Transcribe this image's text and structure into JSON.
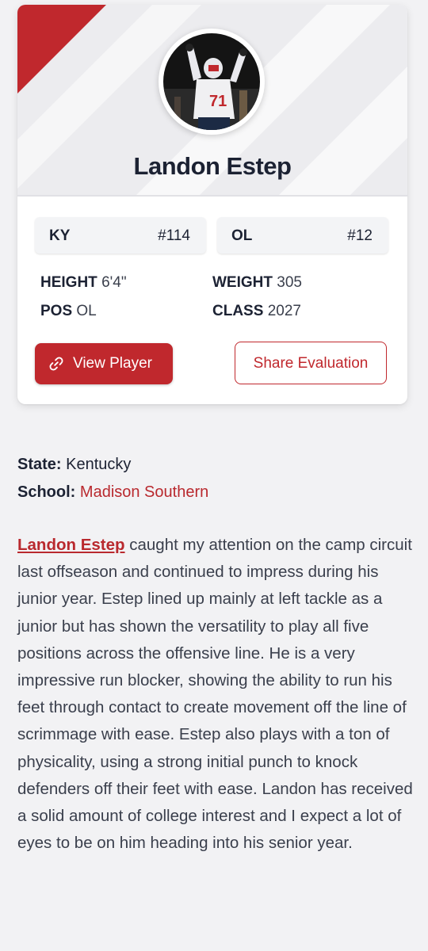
{
  "card": {
    "player_name": "Landon Estep",
    "state_box": {
      "label": "KY",
      "rank": "#114"
    },
    "position_box": {
      "label": "OL",
      "rank": "#12"
    },
    "attributes": {
      "height_label": "HEIGHT",
      "height_value": "6'4\"",
      "weight_label": "WEIGHT",
      "weight_value": "305",
      "pos_label": "POS",
      "pos_value": "OL",
      "class_label": "CLASS",
      "class_value": "2027"
    },
    "view_button_label": "View Player",
    "share_button_label": "Share Evaluation"
  },
  "details": {
    "state_label": "State:",
    "state_value": "Kentucky",
    "school_label": "School:",
    "school_value": "Madison Southern"
  },
  "bio": {
    "name_link": "Landon Estep",
    "text": " caught my attention on the camp circuit last offseason and continued to impress during his junior year. Estep lined up mainly at left tackle as a junior but has shown the versatility to play all five positions across the offensive line. He is a very impressive run blocker, showing the ability to run his feet through contact to create movement off the line of scrimmage with ease. Estep also plays with a ton of physicality, using a strong initial punch to knock defenders off their feet with ease. Landon has received a solid amount of college interest and I expect a lot of eyes to be on him heading into his senior year."
  },
  "colors": {
    "accent": "#c0282d",
    "link": "#b9292e",
    "text": "#1c2233",
    "background": "#f2f2f4"
  }
}
